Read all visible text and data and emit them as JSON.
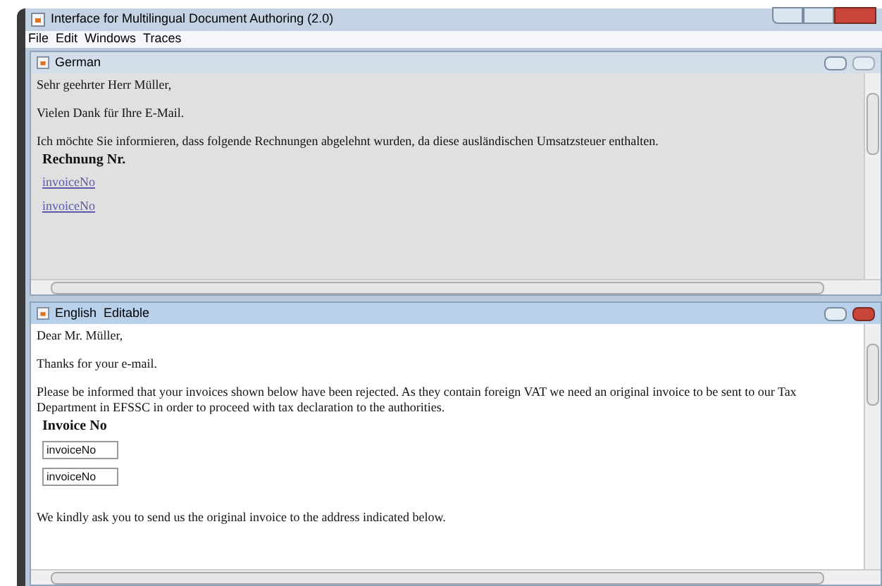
{
  "window": {
    "title": "Interface for Multilingual Document Authoring (2.0)"
  },
  "menu": [
    "File",
    "Edit",
    "Windows",
    "Traces"
  ],
  "frames": [
    {
      "title": "German",
      "editable": false,
      "active": false,
      "paragraphs": [
        "Sehr geehrter Herr Müller,",
        "Vielen Dank für Ihre E-Mail.",
        "Ich möchte Sie informieren, dass folgende Rechnungen abgelehnt wurden, da diese ausländischen Umsatzsteuer enthalten."
      ],
      "heading": "Rechnung Nr.",
      "invoices": [
        "invoiceNo",
        "invoiceNo"
      ]
    },
    {
      "title": "English  Editable",
      "editable": true,
      "active": true,
      "paragraphs": [
        "Dear Mr. Müller,",
        "Thanks for your e-mail.",
        "Please be informed that your invoices shown below have been rejected. As they contain foreign VAT we need an original invoice to be sent to our Tax Department in EFSSC in order to proceed with tax declaration to the authorities."
      ],
      "heading": "Invoice No",
      "invoices": [
        "invoiceNo",
        "invoiceNo"
      ],
      "after": [
        "We kindly ask you to send us the original invoice to the address indicated below."
      ]
    }
  ]
}
